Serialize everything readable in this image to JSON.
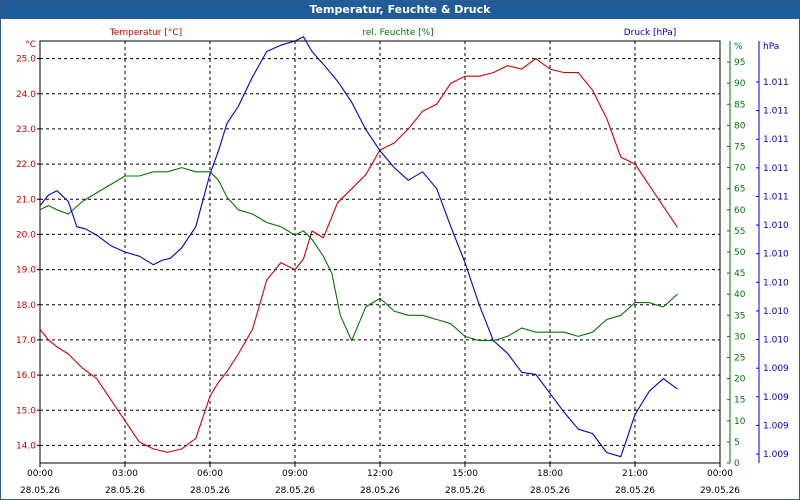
{
  "window": {
    "title": "Temperatur, Feuchte & Druck"
  },
  "chart_data": {
    "type": "line",
    "title": "Temperatur, Feuchte & Druck",
    "grid": true,
    "x_ticks": [
      {
        "time": "00:00",
        "date": "28.05.26"
      },
      {
        "time": "03:00",
        "date": "28.05.26"
      },
      {
        "time": "06:00",
        "date": "28.05.26"
      },
      {
        "time": "09:00",
        "date": "28.05.26"
      },
      {
        "time": "12:00",
        "date": "28.05.26"
      },
      {
        "time": "15:00",
        "date": "28.05.26"
      },
      {
        "time": "18:00",
        "date": "28.05.26"
      },
      {
        "time": "21:00",
        "date": "28.05.26"
      },
      {
        "time": "00:00",
        "date": "29.05.26"
      }
    ],
    "x_range_hours": [
      0,
      24
    ],
    "axes": {
      "temperature": {
        "label": "Temperatur [°C]",
        "unit": "°C",
        "color": "#cc0000",
        "range": [
          13.5,
          25.5
        ],
        "ticks": [
          "14.0",
          "15.0",
          "16.0",
          "17.0",
          "18.0",
          "19.0",
          "20.0",
          "21.0",
          "22.0",
          "23.0",
          "24.0",
          "25.0"
        ]
      },
      "humidity": {
        "label": "rel. Feuchte [%]",
        "unit": "%",
        "color": "#007700",
        "range": [
          0,
          100
        ],
        "ticks": [
          "0",
          "5",
          "10",
          "15",
          "20",
          "25",
          "30",
          "35",
          "40",
          "45",
          "50",
          "55",
          "60",
          "65",
          "70",
          "75",
          "80",
          "85",
          "90",
          "95"
        ]
      },
      "pressure": {
        "label": "Druck [hPa]",
        "unit": "hPa",
        "color": "#0000cc",
        "range": [
          1009.0,
          1011.0
        ],
        "ticks": [
          "1.009",
          "1.009",
          "1.009",
          "1.009",
          "1.010",
          "1.010",
          "1.010",
          "1.010",
          "1.010",
          "1.011",
          "1.011",
          "1.011",
          "1.011",
          "1.011"
        ]
      }
    },
    "series": [
      {
        "name": "Temperatur [°C]",
        "axis": "temperature",
        "color": "#cc0000",
        "x": [
          0,
          0.3,
          0.6,
          1,
          1.5,
          2,
          2.5,
          3,
          3.5,
          4,
          4.5,
          5,
          5.5,
          6,
          6.3,
          6.6,
          7,
          7.5,
          8,
          8.5,
          9,
          9.3,
          9.6,
          10,
          10.5,
          11,
          11.5,
          12,
          12.5,
          13,
          13.5,
          14,
          14.5,
          15,
          15.5,
          16,
          16.5,
          17,
          17.5,
          18,
          18.5,
          19,
          19.5,
          20,
          20.5,
          21,
          21.5,
          22,
          22.5
        ],
        "values": [
          17.3,
          17.0,
          16.8,
          16.6,
          16.2,
          15.9,
          15.3,
          14.7,
          14.1,
          13.9,
          13.8,
          13.9,
          14.2,
          15.4,
          15.8,
          16.1,
          16.6,
          17.3,
          18.7,
          19.2,
          19.0,
          19.3,
          20.1,
          19.9,
          20.9,
          21.3,
          21.7,
          22.4,
          22.6,
          23.0,
          23.5,
          23.7,
          24.3,
          24.5,
          24.5,
          24.6,
          24.8,
          24.7,
          25.0,
          24.7,
          24.6,
          24.6,
          24.1,
          23.3,
          22.2,
          22.0,
          21.4,
          20.8,
          20.2
        ]
      },
      {
        "name": "rel. Feuchte [%]",
        "axis": "humidity",
        "color": "#007700",
        "x": [
          0,
          0.3,
          0.6,
          1,
          1.5,
          2,
          2.5,
          3,
          3.5,
          4,
          4.5,
          5,
          5.5,
          6,
          6.3,
          6.6,
          7,
          7.5,
          8,
          8.5,
          9,
          9.3,
          9.6,
          10,
          10.3,
          10.6,
          11,
          11.5,
          12,
          12.5,
          13,
          13.5,
          14,
          14.5,
          15,
          15.5,
          16,
          16.5,
          17,
          17.5,
          18,
          18.5,
          19,
          19.5,
          20,
          20.5,
          21,
          21.5,
          22,
          22.5
        ],
        "values": [
          60,
          61,
          60,
          59,
          62,
          64,
          66,
          68,
          68,
          69,
          69,
          70,
          69,
          69,
          67,
          63,
          60,
          59,
          57,
          56,
          54,
          55,
          53,
          49,
          45,
          35,
          29,
          37,
          39,
          36,
          35,
          35,
          34,
          33,
          30,
          29,
          29,
          30,
          32,
          31,
          31,
          31,
          30,
          31,
          34,
          35,
          38,
          38,
          37,
          40
        ]
      },
      {
        "name": "Druck [hPa]",
        "axis": "pressure",
        "color": "#0000cc",
        "x": [
          0,
          0.3,
          0.6,
          1,
          1.3,
          1.6,
          2,
          2.5,
          3,
          3.5,
          4,
          4.3,
          4.6,
          5,
          5.5,
          6,
          6.3,
          6.6,
          7,
          7.5,
          8,
          8.5,
          9,
          9.3,
          9.6,
          10,
          10.5,
          11,
          11.5,
          12,
          12.5,
          13,
          13.5,
          14,
          14.5,
          15,
          15.5,
          16,
          16.5,
          17,
          17.5,
          18,
          18.5,
          19,
          19.5,
          20,
          20.5,
          21,
          21.5,
          22,
          22.5
        ],
        "values": [
          1010.22,
          1010.27,
          1010.29,
          1010.24,
          1010.12,
          1010.11,
          1010.08,
          1010.03,
          1010.0,
          1009.98,
          1009.94,
          1009.96,
          1009.97,
          1010.02,
          1010.12,
          1010.37,
          1010.48,
          1010.61,
          1010.69,
          1010.83,
          1010.95,
          1010.98,
          1011.0,
          1011.02,
          1010.95,
          1010.89,
          1010.81,
          1010.71,
          1010.58,
          1010.48,
          1010.4,
          1010.34,
          1010.38,
          1010.3,
          1010.12,
          1009.95,
          1009.75,
          1009.58,
          1009.52,
          1009.43,
          1009.42,
          1009.33,
          1009.24,
          1009.16,
          1009.14,
          1009.05,
          1009.03,
          1009.23,
          1009.34,
          1009.4,
          1009.35
        ]
      }
    ]
  }
}
